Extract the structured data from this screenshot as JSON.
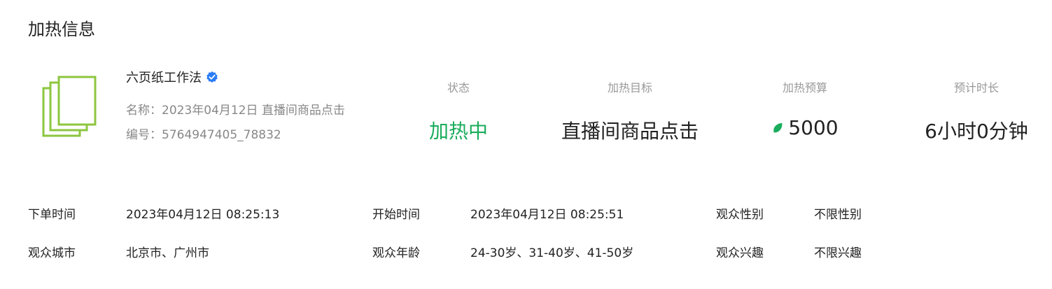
{
  "section_title": "加热信息",
  "account": {
    "name": "六页纸工作法",
    "name_line": "名称：2023年04月12日 直播间商品点击",
    "id_line": "编号：5764947405_78832"
  },
  "stats": [
    {
      "label": "状态",
      "value": "加热中"
    },
    {
      "label": "加热目标",
      "value": "直播间商品点击"
    },
    {
      "label": "加热预算",
      "value": "5000"
    },
    {
      "label": "预计时长",
      "value": "6小时0分钟"
    }
  ],
  "colors": {
    "active": "#1aad5c",
    "verified": "#2b7cf6",
    "logo": "#8dc63f"
  },
  "details": {
    "order_time_label": "下单时间",
    "order_time": "2023年04月12日 08:25:13",
    "start_time_label": "开始时间",
    "start_time": "2023年04月12日 08:25:51",
    "gender_label": "观众性别",
    "gender": "不限性别",
    "city_label": "观众城市",
    "city": "北京市、广州市",
    "age_label": "观众年龄",
    "age": "24-30岁、31-40岁、41-50岁",
    "interest_label": "观众兴趣",
    "interest": "不限兴趣"
  }
}
